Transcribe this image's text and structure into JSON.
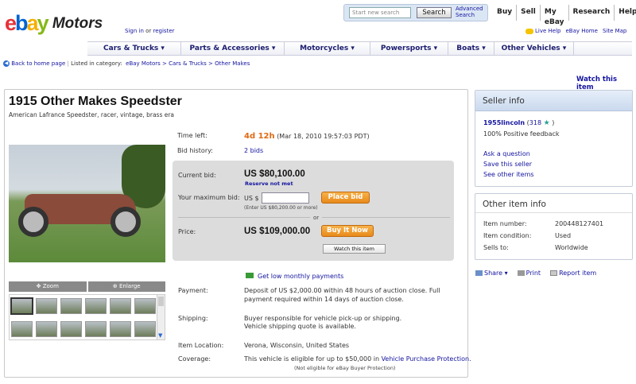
{
  "header": {
    "logo_text": "ebay",
    "logo_sub": "Motors",
    "sign_in": "Sign in",
    "or": "or",
    "register": "register",
    "search_placeholder": "Start new search",
    "search_button": "Search",
    "advanced_search_1": "Advanced",
    "advanced_search_2": "Search",
    "nav": [
      "Buy",
      "Sell",
      "My eBay",
      "Research",
      "Help"
    ],
    "help_links": [
      "Live Help",
      "eBay Home",
      "Site Map"
    ],
    "colors": {
      "ebay_e": "#e53238",
      "ebay_b": "#0064d2",
      "ebay_a": "#f5af02",
      "ebay_y": "#86b817"
    }
  },
  "category_bar": [
    "Cars & Trucks ▾",
    "Parts & Accessories ▾",
    "Motorcycles ▾",
    "Powersports ▾",
    "Boats ▾",
    "Other Vehicles ▾"
  ],
  "breadcrumb": {
    "back": "Back to home page",
    "listed_in": "Listed in category:",
    "path": "eBay Motors > Cars & Trucks > Other Makes"
  },
  "watch_top": "Watch this item",
  "listing": {
    "title": "1915 Other Makes Speedster",
    "subtitle": "American Lafrance Speedster, racer, vintage, brass era",
    "zoom": "Zoom",
    "enlarge": "Enlarge",
    "time_left_label": "Time left:",
    "time_left_value": "4d 12h",
    "time_left_date": "(Mar 18, 2010 19:57:03 PDT)",
    "bid_history_label": "Bid history:",
    "bid_history_value": "2 bids",
    "current_bid_label": "Current bid:",
    "current_bid_value": "US $80,100.00",
    "reserve_note": "Reserve not met",
    "max_bid_label": "Your maximum bid:",
    "max_bid_currency": "US $",
    "place_bid": "Place bid",
    "enter_hint": "(Enter US $80,200.00 or more)",
    "or": "or",
    "price_label": "Price:",
    "price_value": "US $109,000.00",
    "buy_it_now": "Buy It Now",
    "watch_button": "Watch this item",
    "monthly_payments": "Get low monthly payments",
    "payment_label": "Payment:",
    "payment_text": "Deposit of US $2,000.00 within 48 hours of auction close. Full payment required within 14 days of auction close.",
    "shipping_label": "Shipping:",
    "shipping_text": "Buyer responsible for vehicle pick-up or shipping.",
    "shipping_link": "Vehicle shipping quote is available.",
    "location_label": "Item Location:",
    "location_value": "Verona, Wisconsin, United States",
    "coverage_label": "Coverage:",
    "coverage_text": "This vehicle is eligible for up to $50,000 in",
    "coverage_link": "Vehicle Purchase Protection.",
    "coverage_note": "(Not eligible for eBay Buyer Protection)"
  },
  "seller": {
    "header": "Seller info",
    "name": "1955lincoln",
    "feedback_open": "(",
    "score": "318",
    "feedback_close": ")",
    "positive": "100% Positive feedback",
    "links": [
      "Ask a question",
      "Save this seller",
      "See other items"
    ]
  },
  "other_info": {
    "header": "Other item info",
    "rows": [
      {
        "label": "Item number:",
        "value": "200448127401"
      },
      {
        "label": "Item condition:",
        "value": "Used"
      },
      {
        "label": "Sells to:",
        "value": "Worldwide"
      }
    ]
  },
  "share_bar": {
    "share": "Share ▾",
    "print": "Print",
    "report": "Report item"
  }
}
